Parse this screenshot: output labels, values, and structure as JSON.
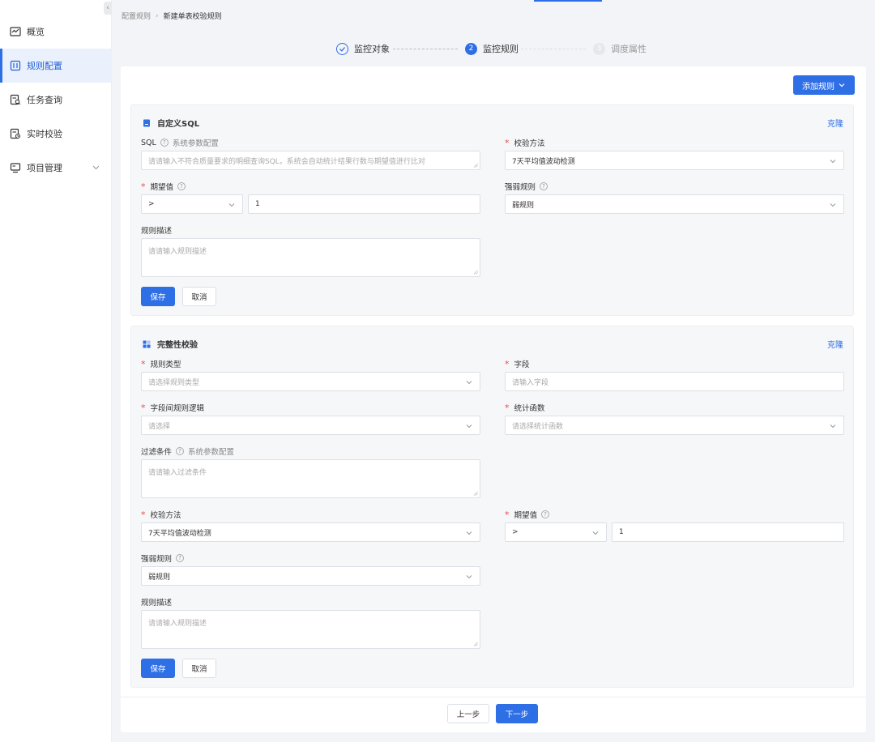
{
  "sidebar": {
    "items": [
      {
        "label": "概览",
        "icon": "dashboard-icon"
      },
      {
        "label": "规则配置",
        "icon": "rule-config-icon"
      },
      {
        "label": "任务查询",
        "icon": "task-query-icon"
      },
      {
        "label": "实时校验",
        "icon": "realtime-check-icon"
      },
      {
        "label": "项目管理",
        "icon": "project-icon"
      }
    ],
    "collapse_glyph": "‹"
  },
  "breadcrumb": {
    "parent": "配置规则",
    "separator": "›",
    "current": "新建单表校验规则"
  },
  "steps": [
    {
      "label": "监控对象",
      "status": "done"
    },
    {
      "label": "监控规则",
      "number": "2",
      "status": "active"
    },
    {
      "label": "调度属性",
      "number": "3",
      "status": "pending"
    }
  ],
  "toolbar": {
    "add_rule_label": "添加规则"
  },
  "sql_card": {
    "title": "自定义SQL",
    "clone_label": "克隆",
    "sql": {
      "label": "SQL",
      "help": "?",
      "extra": "系统参数配置",
      "placeholder": "请请输入不符合质量要求的明细查询SQL，系统会自动统计结果行数与期望值进行比对"
    },
    "method": {
      "required": "*",
      "label": "校验方法",
      "value": "7天平均值波动检测"
    },
    "expect": {
      "required": "*",
      "label": "期望值",
      "help": "?",
      "operator": ">",
      "value": "1"
    },
    "strength": {
      "label": "强弱规则",
      "help": "?",
      "value": "弱规则"
    },
    "desc": {
      "label": "规则描述",
      "placeholder": "请请输入规则描述"
    },
    "save_label": "保存",
    "cancel_label": "取消"
  },
  "complete_card": {
    "title": "完整性校验",
    "clone_label": "克隆",
    "rule_type": {
      "required": "*",
      "label": "规则类型",
      "placeholder": "请选择规则类型"
    },
    "field": {
      "required": "*",
      "label": "字段",
      "placeholder": "请输入字段"
    },
    "logic": {
      "required": "*",
      "label": "字段间规则逻辑",
      "placeholder": "请选择"
    },
    "stat": {
      "required": "*",
      "label": "统计函数",
      "placeholder": "请选择统计函数"
    },
    "filter": {
      "label": "过滤条件",
      "help": "?",
      "extra": "系统参数配置",
      "placeholder": "请请输入过滤条件"
    },
    "method": {
      "required": "*",
      "label": "校验方法",
      "value": "7天平均值波动检测"
    },
    "expect": {
      "required": "*",
      "label": "期望值",
      "help": "?",
      "operator": ">",
      "value": "1"
    },
    "strength": {
      "label": "强弱规则",
      "help": "?",
      "value": "弱规则"
    },
    "desc": {
      "label": "规则描述",
      "placeholder": "请请输入规则描述"
    },
    "save_label": "保存",
    "cancel_label": "取消"
  },
  "footer": {
    "prev_label": "上一步",
    "next_label": "下一步"
  },
  "colors": {
    "primary": "#2f6fe6",
    "required": "#e34d4d",
    "active_nav_bg": "#eaf1fd"
  }
}
